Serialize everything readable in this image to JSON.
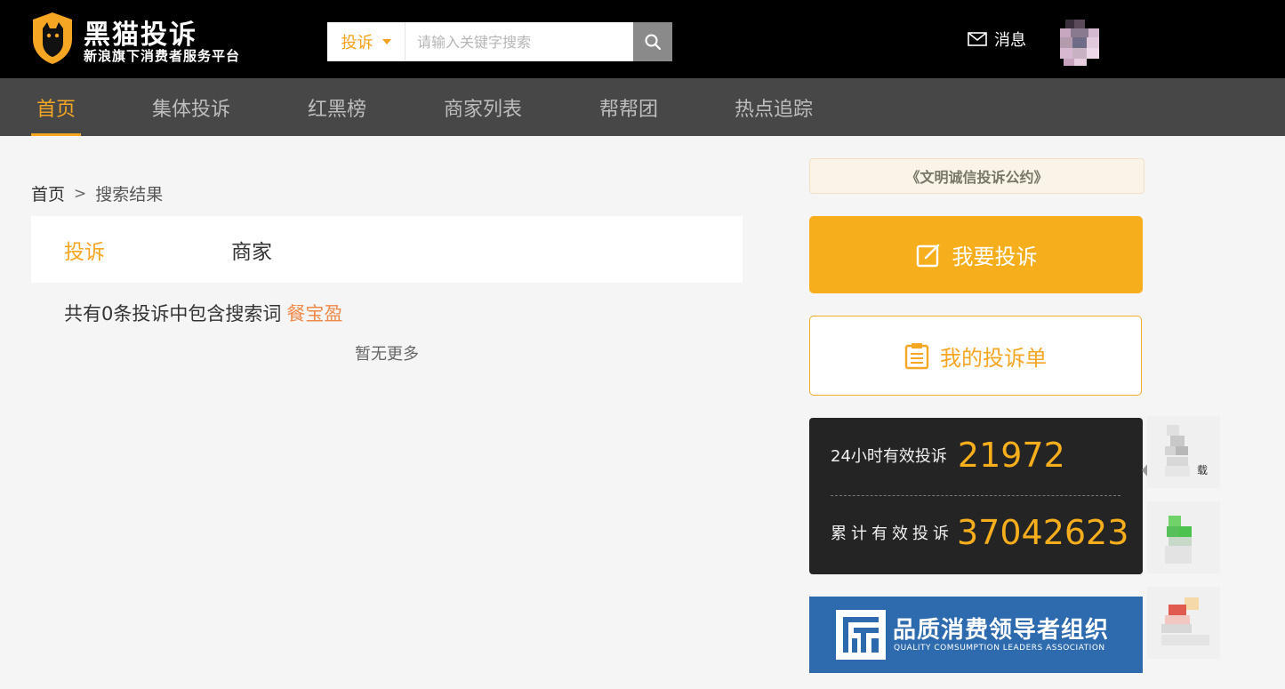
{
  "header": {
    "logo_title": "黑猫投诉",
    "logo_subtitle": "新浪旗下消费者服务平台",
    "search": {
      "type_selected": "投诉",
      "placeholder": "请输入关键字搜索",
      "value": ""
    },
    "message_label": "消息"
  },
  "nav": {
    "items": [
      {
        "label": "首页"
      },
      {
        "label": "集体投诉"
      },
      {
        "label": "红黑榜"
      },
      {
        "label": "商家列表"
      },
      {
        "label": "帮帮团"
      },
      {
        "label": "热点追踪"
      }
    ],
    "active_index": 0
  },
  "breadcrumb": {
    "home": "首页",
    "separator": ">",
    "current": "搜索结果"
  },
  "tabs": {
    "items": [
      {
        "label": "投诉"
      },
      {
        "label": "商家"
      }
    ],
    "active_index": 0
  },
  "result": {
    "summary": "共有0条投诉中包含搜索词",
    "keyword": "餐宝盈",
    "no_more": "暂无更多"
  },
  "sidebar": {
    "pact_label": "《文明诚信投诉公约》",
    "complain_button": "我要投诉",
    "my_list_button": "我的投诉单",
    "stats": {
      "label_24h": "24小时有效投诉",
      "value_24h": "21972",
      "label_total": "累计有效投诉",
      "value_total": "37042623"
    },
    "banner": {
      "title": "品质消费领导者组织",
      "subtitle": "QUALITY COMSUMPTION  LEADERS  ASSOCIATION"
    },
    "side_tool_text": "载"
  },
  "colors": {
    "accent": "#f5a623",
    "topbar": "#000000",
    "navbar": "#474747",
    "keyword": "#f08a4b",
    "banner": "#2d6aae"
  },
  "icons": {
    "logo": "cat-shield-icon",
    "search": "search-icon",
    "message": "envelope-icon",
    "complain": "edit-icon",
    "my_list": "clipboard-icon"
  }
}
